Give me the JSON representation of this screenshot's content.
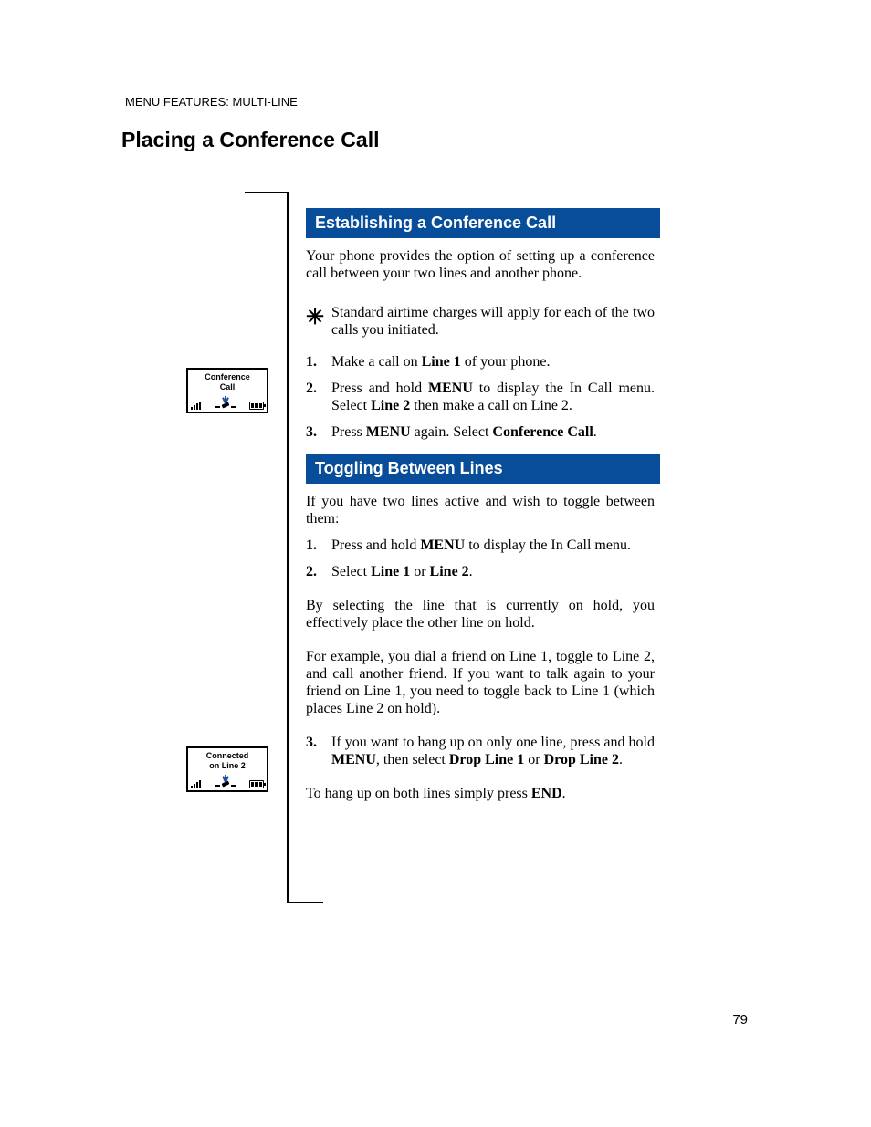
{
  "breadcrumb": "MENU FEATURES: MULTI-LINE",
  "page_title": "Placing a Conference Call",
  "section1": {
    "title": "Establishing a Conference Call",
    "intro": "Your phone provides the option of setting up a conference call between your two lines and another phone.",
    "step1_num": "1.",
    "step1_a": "Make a call on ",
    "step1_b": "Line 1",
    "step1_c": " of your phone.",
    "step2_num": "2.",
    "step2_a": "Press and hold ",
    "step2_b": "MENU",
    "step2_c": " to display the In Call menu. Select ",
    "step2_d": "Line 2",
    "step2_e": " then make a call on Line 2.",
    "step3_num": "3.",
    "step3_a": "Press ",
    "step3_b": "MENU",
    "step3_c": " again. Select ",
    "step3_d": "Conference Call",
    "step3_e": ".",
    "tip": "Standard airtime charges will apply for each of the two calls you initiated."
  },
  "section2": {
    "title": "Toggling Between Lines",
    "intro": "If you have two lines active and wish to toggle between them:",
    "step1_num": "1.",
    "step1_a": "Press and hold ",
    "step1_b": "MENU",
    "step1_c": " to display the In Call menu.",
    "step2_num": "2.",
    "step2_a": "Select ",
    "step2_b": "Line 1",
    "step2_c": " or ",
    "step2_d": "Line 2",
    "step2_e": ".",
    "body2": "By selecting the line that is currently on hold, you effectively place the other line on hold.",
    "body3": "For example, you dial a friend on Line 1, toggle to Line 2, and call another friend. If you want to talk again to your friend on Line 1, you need to toggle back to Line 1 (which places Line 2 on hold).",
    "step3_num": "3.",
    "step3_a": "If you want to hang up on only one line, press and hold ",
    "step3_b": "MENU",
    "step3_c": ", then select ",
    "step3_d": "Drop Line 1",
    "step3_e": " or ",
    "step3_f": "Drop Line 2",
    "step3_g": ".",
    "body4_a": "To hang up on both lines simply press ",
    "body4_b": "END",
    "body4_c": "."
  },
  "screen1": {
    "line1": "Conference",
    "line2": "Call"
  },
  "screen2": {
    "line1": "Connected",
    "line2": "on Line 2"
  },
  "page_number": "79"
}
